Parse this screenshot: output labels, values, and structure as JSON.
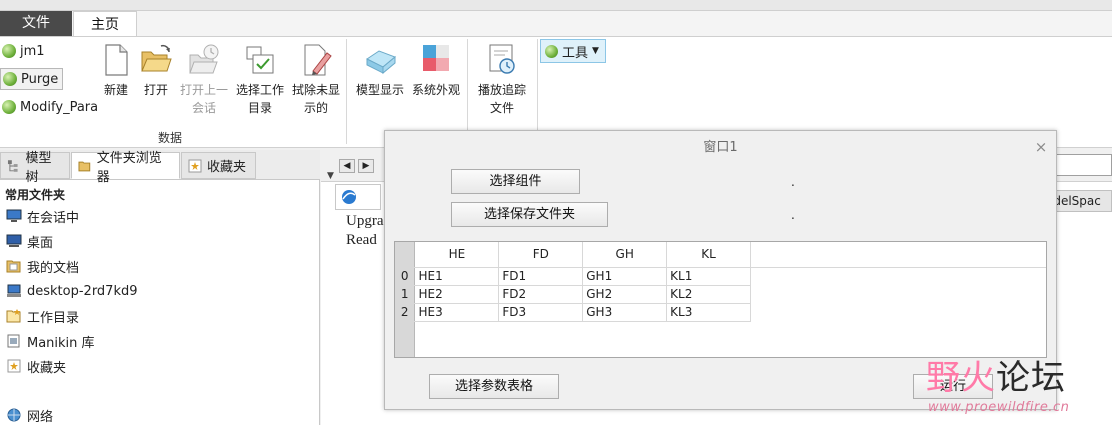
{
  "menu": {
    "file_tab": "文件",
    "home_tab": "主页"
  },
  "ribbon": {
    "mapkeys": [
      "jm1",
      "Purge",
      "Modify_Para"
    ],
    "buttons": {
      "new": "新建",
      "open": "打开",
      "open_last": "打开上一会话",
      "select_workdir": "选择工作目录",
      "erase_undisplayed": "拭除未显示的",
      "model_display": "模型显示",
      "system_appearance": "系统外观",
      "play_trail": "播放追踪文件"
    },
    "group_label": "数据",
    "tools_label": "工具"
  },
  "leftnav": {
    "tabs": [
      "模型树",
      "文件夹浏览器",
      "收藏夹"
    ],
    "section_title": "常用文件夹",
    "items": [
      "在会话中",
      "桌面",
      "我的文档",
      "desktop-2rd7kd9",
      "工作目录",
      "Manikin 库",
      "收藏夹",
      "网络"
    ]
  },
  "browser": {
    "tab_right_text": "odelSpac",
    "page_lines": [
      "Upgra",
      "Read"
    ]
  },
  "dialog": {
    "title": "窗口1",
    "close": "×",
    "select_component": "选择组件",
    "select_save_folder": "选择保存文件夹",
    "dot1": ".",
    "dot2": ".",
    "select_param_table": "选择参数表格",
    "run": "运行",
    "table": {
      "headers": [
        "HE",
        "FD",
        "GH",
        "KL"
      ],
      "rows": [
        {
          "index": "0",
          "cells": [
            "HE1",
            "FD1",
            "GH1",
            "KL1"
          ]
        },
        {
          "index": "1",
          "cells": [
            "HE2",
            "FD2",
            "GH2",
            "KL2"
          ]
        },
        {
          "index": "2",
          "cells": [
            "HE3",
            "FD3",
            "GH3",
            "KL3"
          ]
        }
      ]
    }
  },
  "watermark": {
    "part1": "野火",
    "part2": "论坛",
    "url": "www.proewildfire.cn"
  }
}
